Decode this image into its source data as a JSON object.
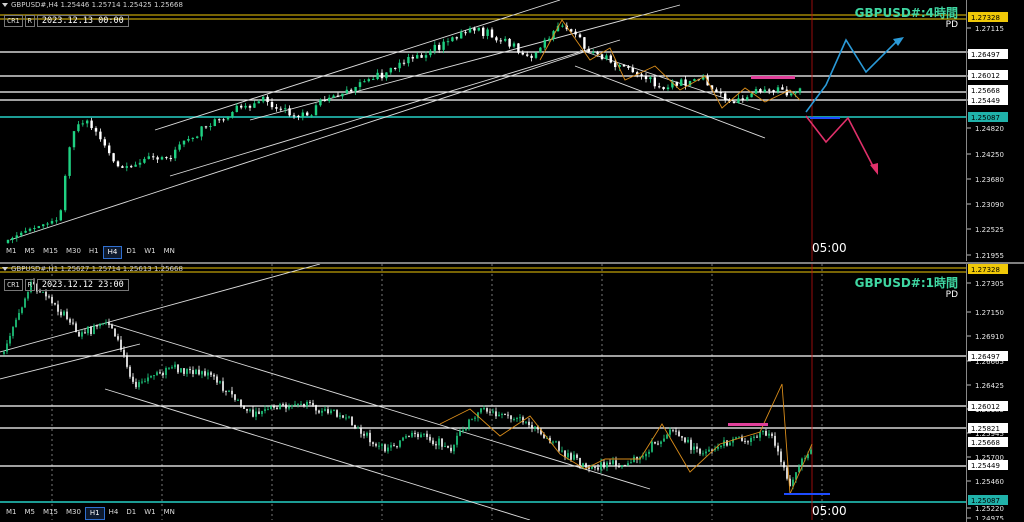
{
  "panels": [
    {
      "id": "h4",
      "symbol_line": "GBPUSD#,H4  1.25446 1.25714 1.25425 1.25668",
      "cr_label": "CR1",
      "r_label": "R",
      "datetime": "2023.12.13 00:00",
      "title": "GBPUSD#:4時間",
      "pd": "PD",
      "time_label": "05:00",
      "timeframes": [
        "M1",
        "M5",
        "M15",
        "M30",
        "H1",
        "H4",
        "D1",
        "W1",
        "MN"
      ],
      "active_timeframe": "H4",
      "price_ticks": [
        "1.27115",
        "1.26497",
        "1.26012",
        "1.25449",
        "1.24820",
        "1.24250",
        "1.23680",
        "1.23090",
        "1.22525",
        "1.21955"
      ],
      "level_labels": [
        {
          "text": "1.27328",
          "color": "#f0c808"
        },
        {
          "text": "1.26497",
          "color": "#ffffff"
        },
        {
          "text": "1.26012",
          "color": "#ffffff"
        },
        {
          "text": "1.25668",
          "color": "#ffffff"
        },
        {
          "text": "1.25449",
          "color": "#ffffff"
        },
        {
          "text": "1.25087",
          "color": "#20b2aa"
        }
      ]
    },
    {
      "id": "h1",
      "symbol_line": "GBPUSD#,H1  1.25627 1.25714 1.25613 1.25668",
      "cr_label": "CR1",
      "r_label": "R",
      "datetime": "2023.12.12 23:00",
      "title": "GBPUSD#:1時間",
      "pd": "PD",
      "time_label": "05:00",
      "timeframes": [
        "M1",
        "M5",
        "M15",
        "M30",
        "H1",
        "H4",
        "D1",
        "W1",
        "MN"
      ],
      "active_timeframe": "H1",
      "price_ticks": [
        "1.27305",
        "1.27150",
        "1.26910",
        "1.26665",
        "1.26425",
        "1.26185",
        "1.25945",
        "1.25700",
        "1.25460",
        "1.25220",
        "1.24975"
      ],
      "level_labels": [
        {
          "text": "1.27328",
          "color": "#f0c808"
        },
        {
          "text": "1.26497",
          "color": "#ffffff"
        },
        {
          "text": "1.26012",
          "color": "#ffffff"
        },
        {
          "text": "1.25821",
          "color": "#ffffff"
        },
        {
          "text": "1.25668",
          "color": "#ffffff"
        },
        {
          "text": "1.25449",
          "color": "#ffffff"
        },
        {
          "text": "1.25087",
          "color": "#20b2aa"
        }
      ]
    }
  ],
  "colors": {
    "bull": "#1fd182",
    "bear": "#ffffff",
    "level": "#ffffff",
    "support": "#20b2aa",
    "gold": "#f0c808",
    "zigzag": "#d98c1a",
    "resistance_mark": "#e0409a",
    "support_mark": "#1e4cff",
    "up_scenario": "#2a9ad8",
    "down_scenario": "#e0306a",
    "vline": "#c01010"
  }
}
